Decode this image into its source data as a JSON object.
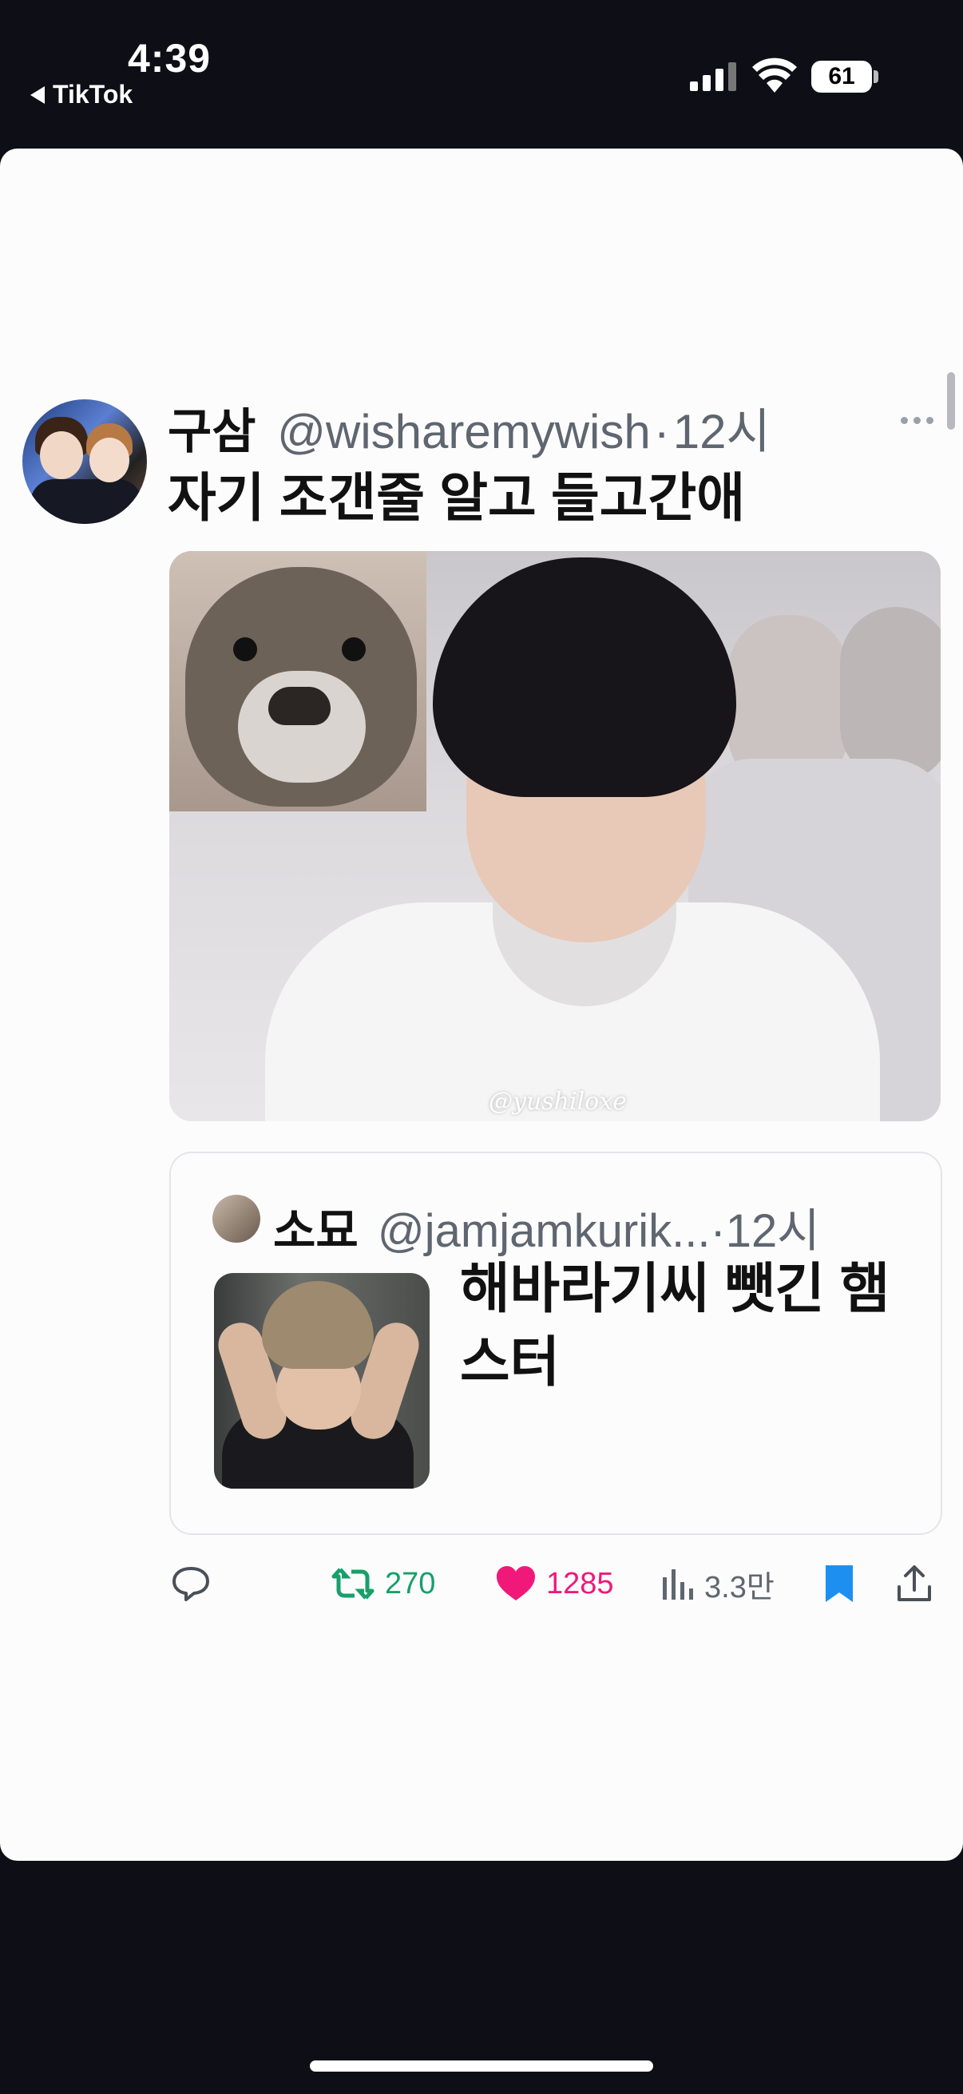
{
  "status_bar": {
    "time": "4:39",
    "back_app": "TikTok",
    "battery": "61"
  },
  "tweet": {
    "display_name": "구삼",
    "handle": "@wisharemywish",
    "separator": "·",
    "time": "12시",
    "text": "자기 조갠줄 알고 들고간애",
    "media_watermark": "@yushiloxe"
  },
  "quote": {
    "display_name": "소묘",
    "handle": "@jamjamkurik...",
    "separator": "·",
    "time": "12시",
    "text": "해바라기씨 뺏긴 햄스터"
  },
  "actions": {
    "retweets": "270",
    "likes": "1285",
    "views": "3.3만"
  },
  "colors": {
    "retweet": "#17a06a",
    "like": "#f0197a",
    "bookmark": "#1d8ff0"
  }
}
